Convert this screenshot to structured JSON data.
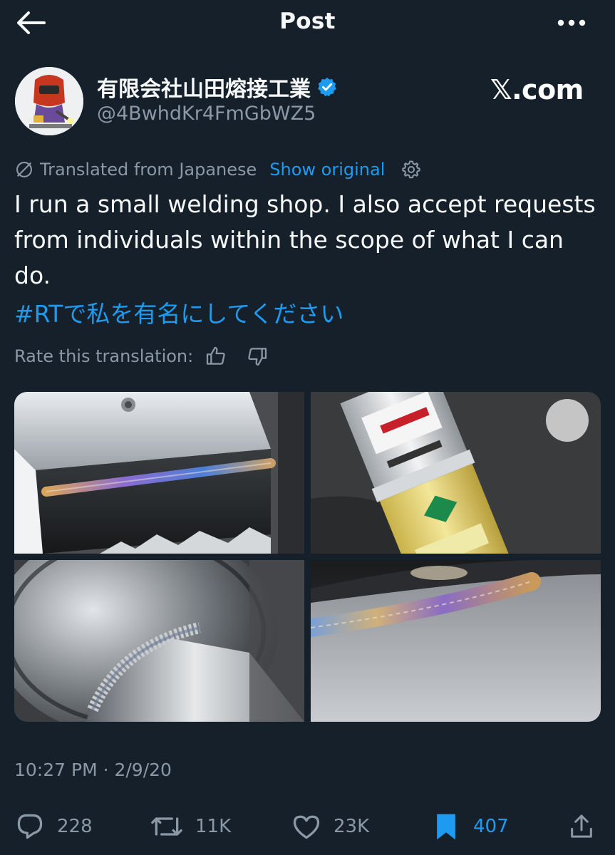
{
  "header": {
    "title": "Post",
    "back_icon": "arrow-left-icon",
    "more_icon": "more-horizontal-icon"
  },
  "author": {
    "display_name": "有限会社山田熔接工業",
    "handle": "@4BwhdKr4FmGbWZ5",
    "verified": true
  },
  "watermark": "𝕏.com",
  "translation": {
    "label": "Translated from Japanese",
    "show_original": "Show original"
  },
  "post": {
    "text": "I run a small welding shop. I also accept requests from individuals within the scope of what I can do.",
    "hashtag": "#RTで私を有名にしてください"
  },
  "rate": {
    "label": "Rate this translation:"
  },
  "timestamp": "10:27 PM · 2/9/20",
  "actions": {
    "replies": "228",
    "reposts": "11K",
    "likes": "23K",
    "bookmarks": "407"
  },
  "colors": {
    "background": "#15202b",
    "accent": "#1d9bf0",
    "secondary_text": "#8b98a5"
  }
}
